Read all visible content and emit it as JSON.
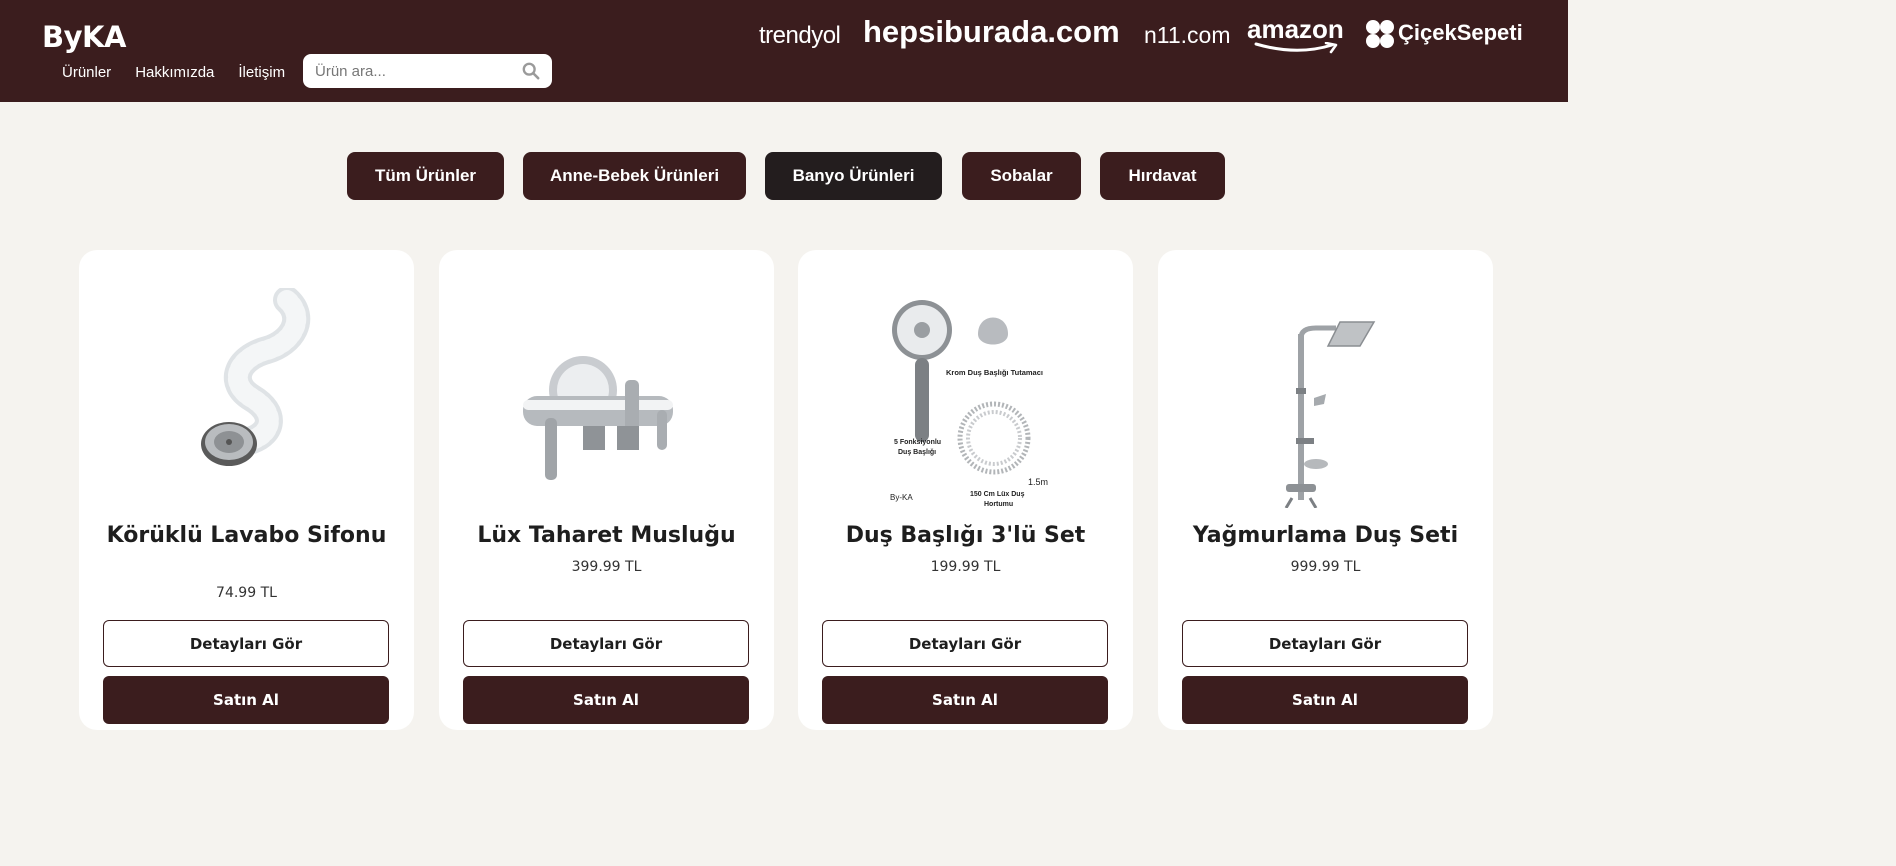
{
  "brand": {
    "logo": "ByKA"
  },
  "nav": [
    {
      "label": "Ürünler"
    },
    {
      "label": "Hakkımızda"
    },
    {
      "label": "İletişim"
    }
  ],
  "search": {
    "placeholder": "Ürün ara...",
    "icon": "search-icon"
  },
  "partners": {
    "trendyol": "trendyol",
    "hepsiburada": "hepsiburada.com",
    "n11": "n11.com",
    "amazon": "amazon",
    "ciceksepeti": "ÇiçekSepeti"
  },
  "categories": [
    {
      "label": "Tüm Ürünler"
    },
    {
      "label": "Anne-Bebek Ürünleri"
    },
    {
      "label": "Banyo Ürünleri",
      "active": true
    },
    {
      "label": "Sobalar"
    },
    {
      "label": "Hırdavat"
    }
  ],
  "products": [
    {
      "name": "Körüklü Lavabo Sifonu",
      "price": "74.99 TL",
      "details_label": "Detayları Gör",
      "buy_label": "Satın Al"
    },
    {
      "name": "Lüx Taharet Musluğu",
      "price": "399.99 TL",
      "details_label": "Detayları Gör",
      "buy_label": "Satın Al"
    },
    {
      "name": "Duş Başlığı 3'lü Set",
      "price": "199.99 TL",
      "details_label": "Detayları Gör",
      "buy_label": "Satın Al",
      "image_labels": {
        "holder": "Krom Duş Başlığı Tutamacı",
        "head_line1": "5 Fonksiyonlu",
        "head_line2": "Duş Başlığı",
        "length": "1.5m",
        "hose_line1": "150 Cm Lüx Duş",
        "hose_line2": "Hortumu",
        "brand": "By-KA"
      }
    },
    {
      "name": "Yağmurlama Duş Seti",
      "price": "999.99 TL",
      "details_label": "Detayları Gör",
      "buy_label": "Satın Al"
    }
  ],
  "colors": {
    "brand": "#3b1d1e",
    "active_category": "#231d1e",
    "background": "#f5f3ef"
  }
}
